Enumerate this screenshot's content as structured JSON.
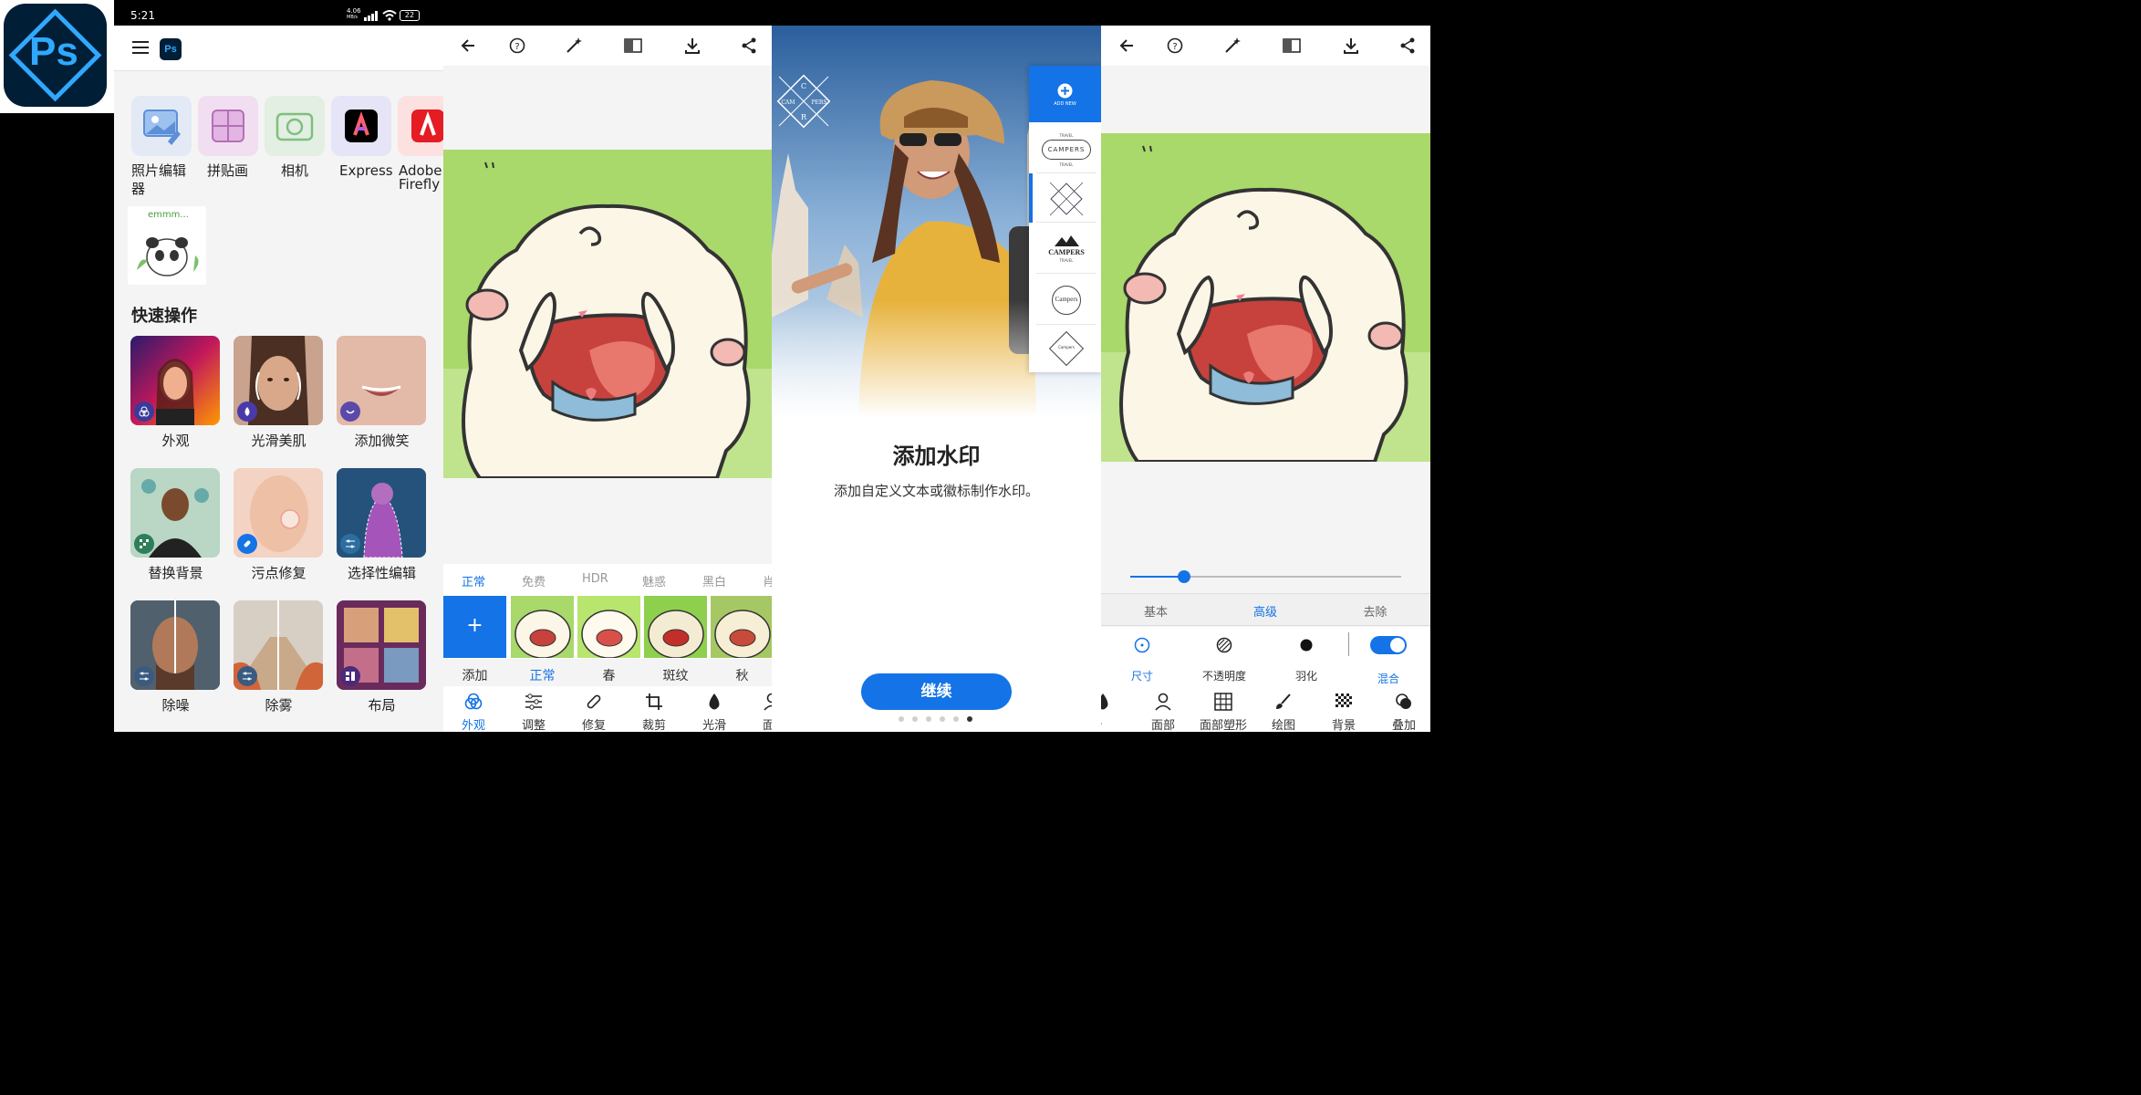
{
  "status_bar": {
    "time": "5:21",
    "net": "4.06",
    "net_unit": "MB/s",
    "battery": "22"
  },
  "app_icon": {
    "text": "Ps",
    "name": "ps-app-icon"
  },
  "home": {
    "apps": [
      {
        "label": "照片编辑",
        "label2": "器"
      },
      {
        "label": "拼贴画",
        "label2": ""
      },
      {
        "label": "相机",
        "label2": ""
      },
      {
        "label": "Express",
        "label2": ""
      },
      {
        "label": "Adobe",
        "label2": "Firefly"
      }
    ],
    "sticker_text": "emmm...",
    "section_title": "快速操作",
    "quick_actions": [
      {
        "label": "外观"
      },
      {
        "label": "光滑美肌"
      },
      {
        "label": "添加微笑"
      },
      {
        "label": "替换背景"
      },
      {
        "label": "污点修复"
      },
      {
        "label": "选择性编辑"
      },
      {
        "label": "除噪"
      },
      {
        "label": "除雾"
      },
      {
        "label": "布局"
      }
    ]
  },
  "editor": {
    "filter_tabs": [
      "正常",
      "免费",
      "HDR",
      "魅惑",
      "黑白",
      "肖"
    ],
    "active_tab": "正常",
    "add_label": "添加",
    "add_symbol": "+",
    "presets": [
      "正常",
      "春",
      "斑纹",
      "秋"
    ],
    "bottom_tools": [
      "外观",
      "调整",
      "修复",
      "裁剪",
      "光滑",
      "面"
    ]
  },
  "watermark": {
    "add_new": "ADD NEW",
    "logo_letters": [
      "C",
      "CAM",
      "PERS",
      "R"
    ],
    "logos": [
      {
        "top": "TRAVEL",
        "main": "CAMPERS",
        "bottom": "TRAVEL"
      },
      {
        "main": "CAMPERS",
        "bottom": "TRAVEL"
      },
      {
        "main": "Campers"
      },
      {
        "main": "Campers"
      }
    ],
    "title": "添加水印",
    "description": "添加自定义文本或徽标制作水印。",
    "continue_button": "继续",
    "page_count": 6,
    "current_page": 6
  },
  "editor2": {
    "slider_value": 0.2,
    "tabs": [
      "基本",
      "高级",
      "去除"
    ],
    "active_tab": "高级",
    "options": [
      "尺寸",
      "不透明度",
      "羽化"
    ],
    "blend_label": "混合",
    "blend_on": true,
    "bottom_tools": [
      "滑",
      "面部",
      "面部塑形",
      "绘图",
      "背景",
      "叠加"
    ]
  },
  "colors": {
    "accent": "#1473e6",
    "ps_blue": "#31a8ff",
    "ps_bg": "#001e36"
  }
}
